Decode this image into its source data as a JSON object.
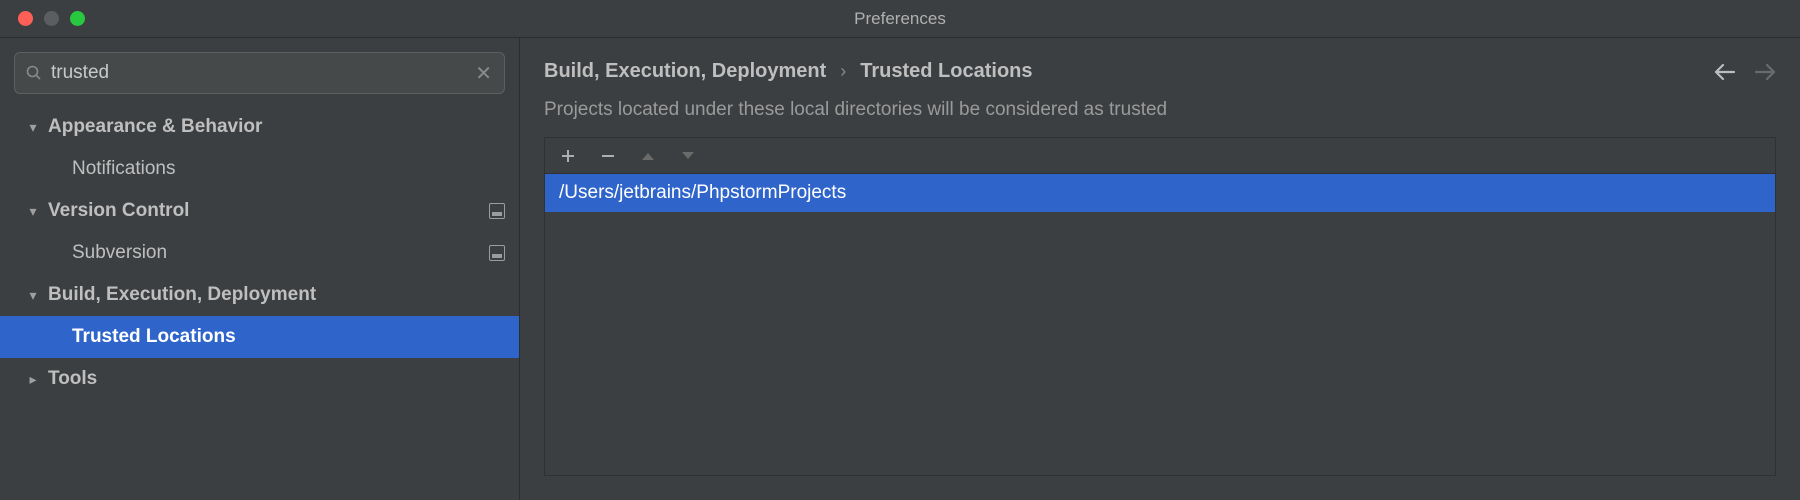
{
  "window": {
    "title": "Preferences"
  },
  "search": {
    "value": "trusted"
  },
  "sidebar": {
    "items": [
      {
        "label": "Appearance & Behavior",
        "expandable": true,
        "expanded": true,
        "showSettingsIcon": false
      },
      {
        "label": "Notifications",
        "child": true
      },
      {
        "label": "Version Control",
        "expandable": true,
        "expanded": true,
        "showSettingsIcon": true
      },
      {
        "label": "Subversion",
        "child": true,
        "showSettingsIcon": true
      },
      {
        "label": "Build, Execution, Deployment",
        "expandable": true,
        "expanded": true
      },
      {
        "label": "Trusted Locations",
        "child": true,
        "selected": true
      },
      {
        "label": "Tools",
        "expandable": true,
        "expanded": false
      }
    ]
  },
  "breadcrumb": {
    "parent": "Build, Execution, Deployment",
    "current": "Trusted Locations"
  },
  "content": {
    "description": "Projects located under these local directories will be considered as trusted",
    "locations": [
      {
        "path": "/Users/jetbrains/PhpstormProjects",
        "selected": true
      }
    ]
  }
}
